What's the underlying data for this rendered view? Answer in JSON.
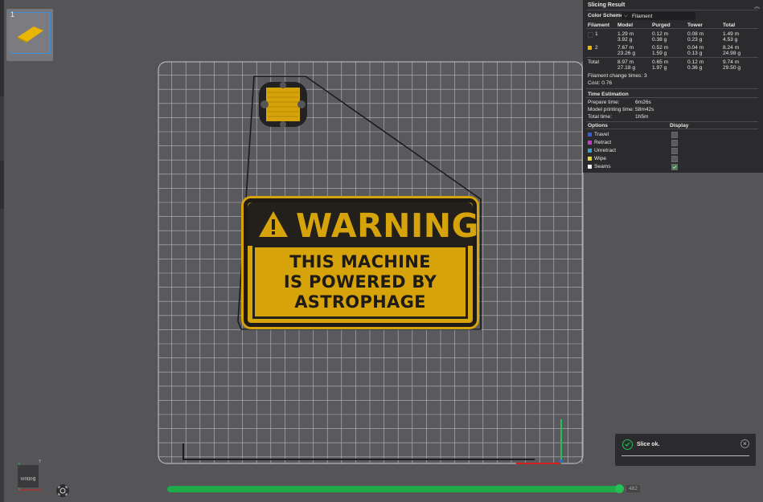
{
  "plate": {
    "number": "1"
  },
  "sign": {
    "header": "WARNING",
    "lines": [
      "THIS MACHINE",
      "IS POWERED BY",
      "ASTROPHAGE"
    ]
  },
  "panel": {
    "title": "Slicing Result",
    "color_scheme_label": "Color Scheme",
    "color_scheme_value": "Filament",
    "headers": [
      "Filament",
      "Model",
      "Purged",
      "Tower",
      "Total"
    ],
    "rows": [
      {
        "id": "1",
        "color": "#2b2b2d",
        "model": [
          "1.29 m",
          "3.92 g"
        ],
        "purged": [
          "0.12 m",
          "0.38 g"
        ],
        "tower": [
          "0.08 m",
          "0.23 g"
        ],
        "total": [
          "1.49 m",
          "4.53 g"
        ]
      },
      {
        "id": "2",
        "color": "#e8b500",
        "model": [
          "7.67 m",
          "23.26 g"
        ],
        "purged": [
          "0.52 m",
          "1.59 g"
        ],
        "tower": [
          "0.04 m",
          "0.13 g"
        ],
        "total": [
          "8.24 m",
          "24.98 g"
        ]
      }
    ],
    "total": {
      "label": "Total",
      "model": [
        "8.97 m",
        "27.18 g"
      ],
      "purged": [
        "0.65 m",
        "1.97 g"
      ],
      "tower": [
        "0.12 m",
        "0.36 g"
      ],
      "total": [
        "9.74 m",
        "29.50 g"
      ]
    },
    "filament_change": "Filament change times:  3",
    "cost": "Cost:  0.76",
    "time_title": "Time Estimation",
    "prepare_label": "Prepare time:",
    "prepare_value": "6m26s",
    "model_time_label": "Model printing time:",
    "model_time_value": "58m42s",
    "total_time_label": "Total time:",
    "total_time_value": "1h5m",
    "options_label": "Options",
    "display_label": "Display",
    "options": [
      {
        "name": "Travel",
        "color": "#3c5bd6",
        "checked": false
      },
      {
        "name": "Retract",
        "color": "#c13ad1",
        "checked": false
      },
      {
        "name": "Unretract",
        "color": "#3aa0d1",
        "checked": false
      },
      {
        "name": "Wipe",
        "color": "#e8d83a",
        "checked": false
      },
      {
        "name": "Seams",
        "color": "#f2f2f2",
        "checked": true
      }
    ]
  },
  "toast": {
    "message": "Slice ok."
  },
  "view": {
    "label": "Bottom",
    "y_axis": "Y"
  },
  "slider": {
    "value": "482"
  }
}
